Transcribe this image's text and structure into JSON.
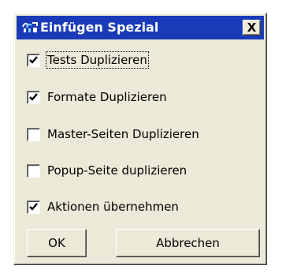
{
  "window": {
    "title": "Einfügen Spezial",
    "icon": "app-icon",
    "close_label": "X",
    "titlebar_color": "#1a3bb8",
    "face_color": "#ece9d8"
  },
  "options": [
    {
      "label": "Tests Duplizieren",
      "checked": true,
      "focused": true
    },
    {
      "label": "Formate Duplizieren",
      "checked": true,
      "focused": false
    },
    {
      "label": "Master-Seiten Duplizieren",
      "checked": false,
      "focused": false
    },
    {
      "label": "Popup-Seite duplizieren",
      "checked": false,
      "focused": false
    },
    {
      "label": "Aktionen übernehmen",
      "checked": true,
      "focused": false
    }
  ],
  "buttons": {
    "ok_label": "OK",
    "cancel_label": "Abbrechen"
  }
}
